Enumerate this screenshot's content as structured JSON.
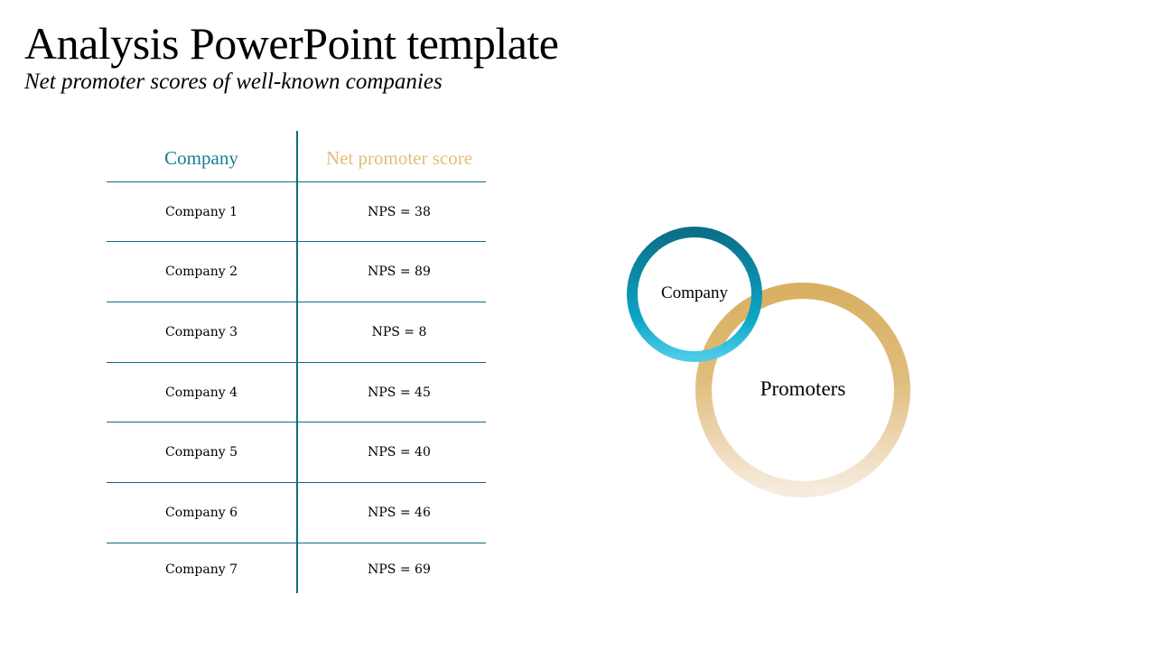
{
  "slide": {
    "title": "Analysis PowerPoint template",
    "subtitle": "Net promoter scores of well-known companies"
  },
  "table": {
    "headers": {
      "company": "Company",
      "nps": "Net promoter score"
    },
    "rows": [
      {
        "company": "Company 1",
        "nps": "NPS = 38"
      },
      {
        "company": "Company 2",
        "nps": "NPS = 89"
      },
      {
        "company": "Company 3",
        "nps": "NPS = 8"
      },
      {
        "company": "Company 4",
        "nps": "NPS = 45"
      },
      {
        "company": "Company 5",
        "nps": "NPS = 40"
      },
      {
        "company": "Company 6",
        "nps": "NPS = 46"
      },
      {
        "company": "Company 7",
        "nps": "NPS = 69"
      }
    ]
  },
  "diagram": {
    "small_circle_label": "Company",
    "large_circle_label": "Promoters"
  },
  "colors": {
    "teal_dark": "#0b6f88",
    "teal_light": "#46c8e4",
    "gold": "#d9b062",
    "gold_light": "#f6ecdd",
    "rule": "#12688a",
    "header_company": "#157f93",
    "header_nps": "#e2bd7b"
  }
}
